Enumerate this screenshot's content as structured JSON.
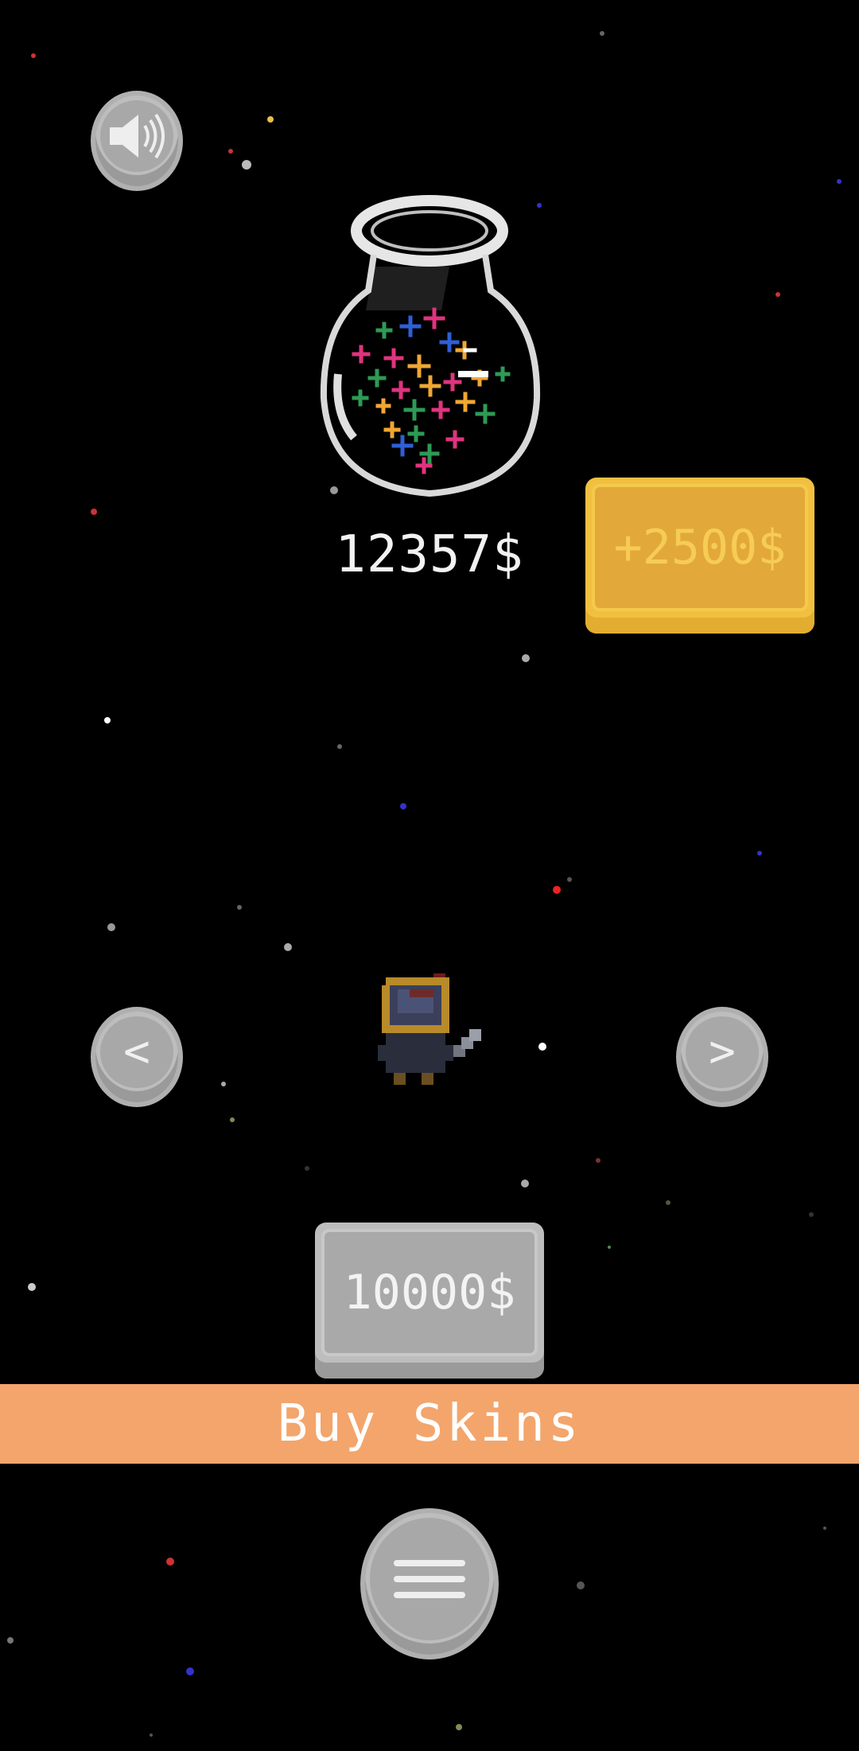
{
  "balance": "12357$",
  "bonus_button": {
    "label": "+2500$"
  },
  "skin_price_button": {
    "label": "10000$"
  },
  "buy_banner": {
    "label": "Buy Skins"
  },
  "nav": {
    "prev": "<",
    "next": ">"
  },
  "icons": {
    "sound": "speaker-icon",
    "menu": "hamburger-menu-icon",
    "jar": "star-jar-icon",
    "character": "helmet-knight-character"
  },
  "colors": {
    "background": "#000000",
    "bonus_button": "#e2a93a",
    "price_button": "#a9a9a9",
    "buy_banner": "#f3a56c",
    "round_button": "#bdbdbd"
  }
}
